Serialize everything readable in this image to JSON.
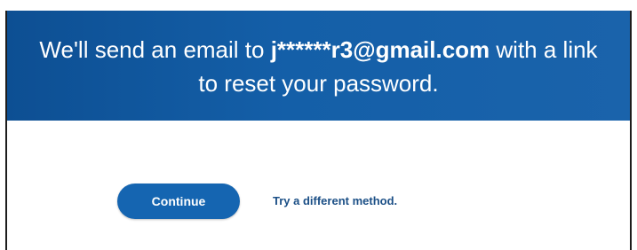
{
  "banner": {
    "text_before": "We'll send an email to ",
    "email": "j******r3@gmail.com",
    "text_after_line1": " with a link",
    "line2": "to reset your password."
  },
  "actions": {
    "continue_label": "Continue",
    "alternate_link": "Try a different method."
  },
  "colors": {
    "banner_start": "#0d4f93",
    "banner_end": "#1a63ab",
    "button": "#1565b1",
    "link": "#1b4f86"
  }
}
